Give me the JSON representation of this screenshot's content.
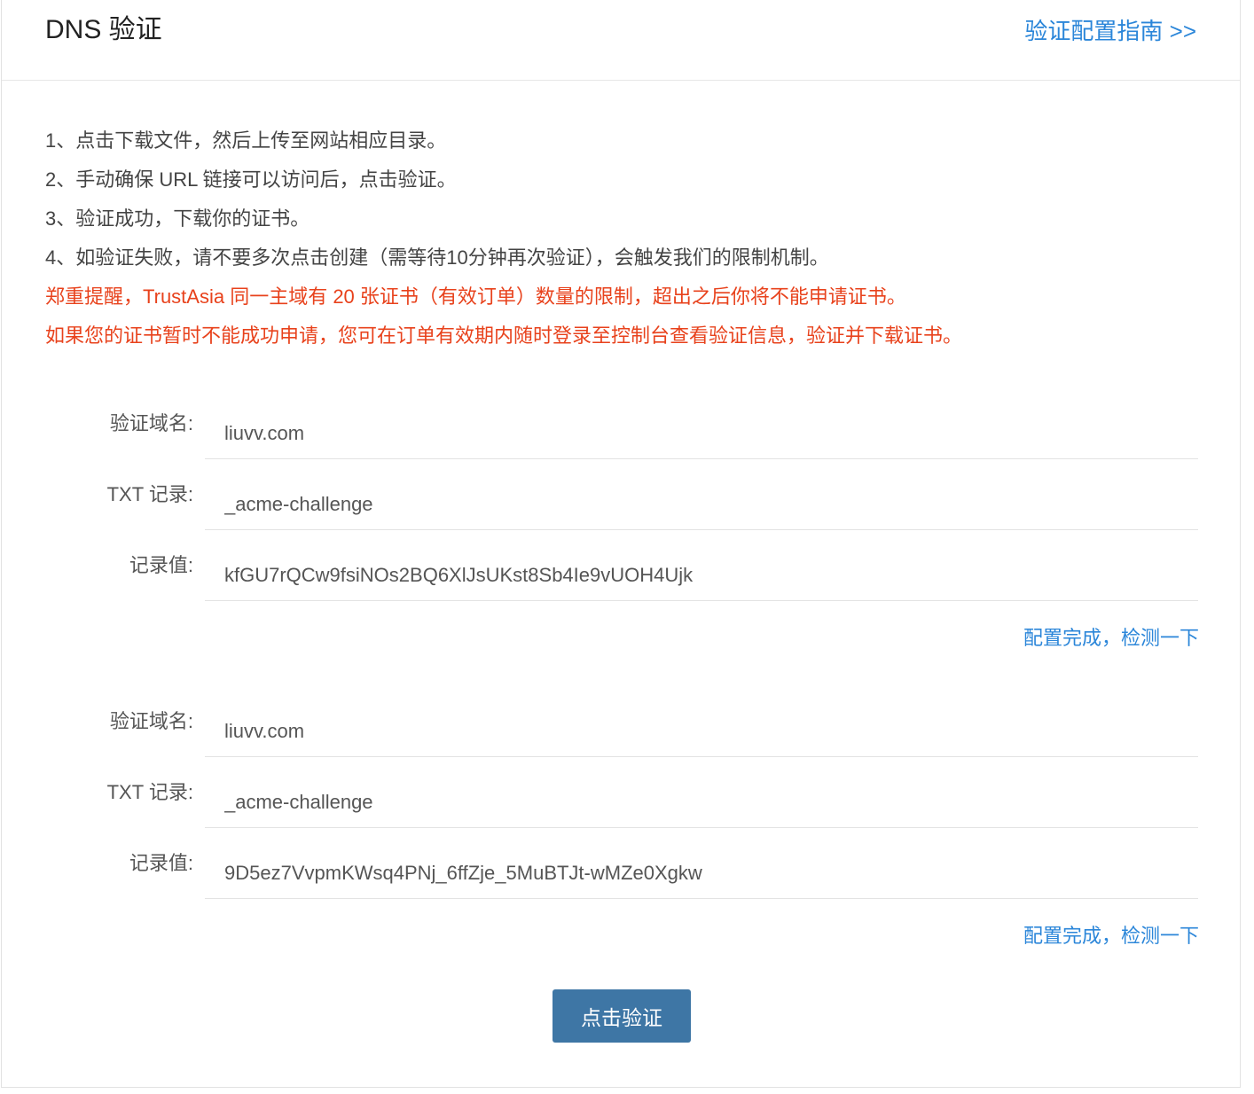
{
  "header": {
    "title": "DNS 验证",
    "guide_link": "验证配置指南 >>"
  },
  "instructions": [
    "1、点击下载文件，然后上传至网站相应目录。",
    "2、手动确保 URL 链接可以访问后，点击验证。",
    "3、验证成功，下载你的证书。",
    "4、如验证失败，请不要多次点击创建（需等待10分钟再次验证），会触发我们的限制机制。"
  ],
  "warnings": [
    "郑重提醒，TrustAsia 同一主域有 20 张证书（有效订单）数量的限制，超出之后你将不能申请证书。",
    "如果您的证书暂时不能成功申请，您可在订单有效期内随时登录至控制台查看验证信息，验证并下载证书。"
  ],
  "labels": {
    "domain": "验证域名:",
    "txt_record": "TXT 记录:",
    "record_value": "记录值:"
  },
  "records": [
    {
      "domain": "liuvv.com",
      "txt_record": "_acme-challenge",
      "record_value": "kfGU7rQCw9fsiNOs2BQ6XlJsUKst8Sb4Ie9vUOH4Ujk",
      "check_link": "配置完成，检测一下"
    },
    {
      "domain": "liuvv.com",
      "txt_record": "_acme-challenge",
      "record_value": "9D5ez7VvpmKWsq4PNj_6ffZje_5MuBTJt-wMZe0Xgkw",
      "check_link": "配置完成，检测一下"
    }
  ],
  "verify_button": "点击验证",
  "colors": {
    "link": "#2b86d9",
    "warning": "#e8421c",
    "button": "#3e76a5"
  }
}
